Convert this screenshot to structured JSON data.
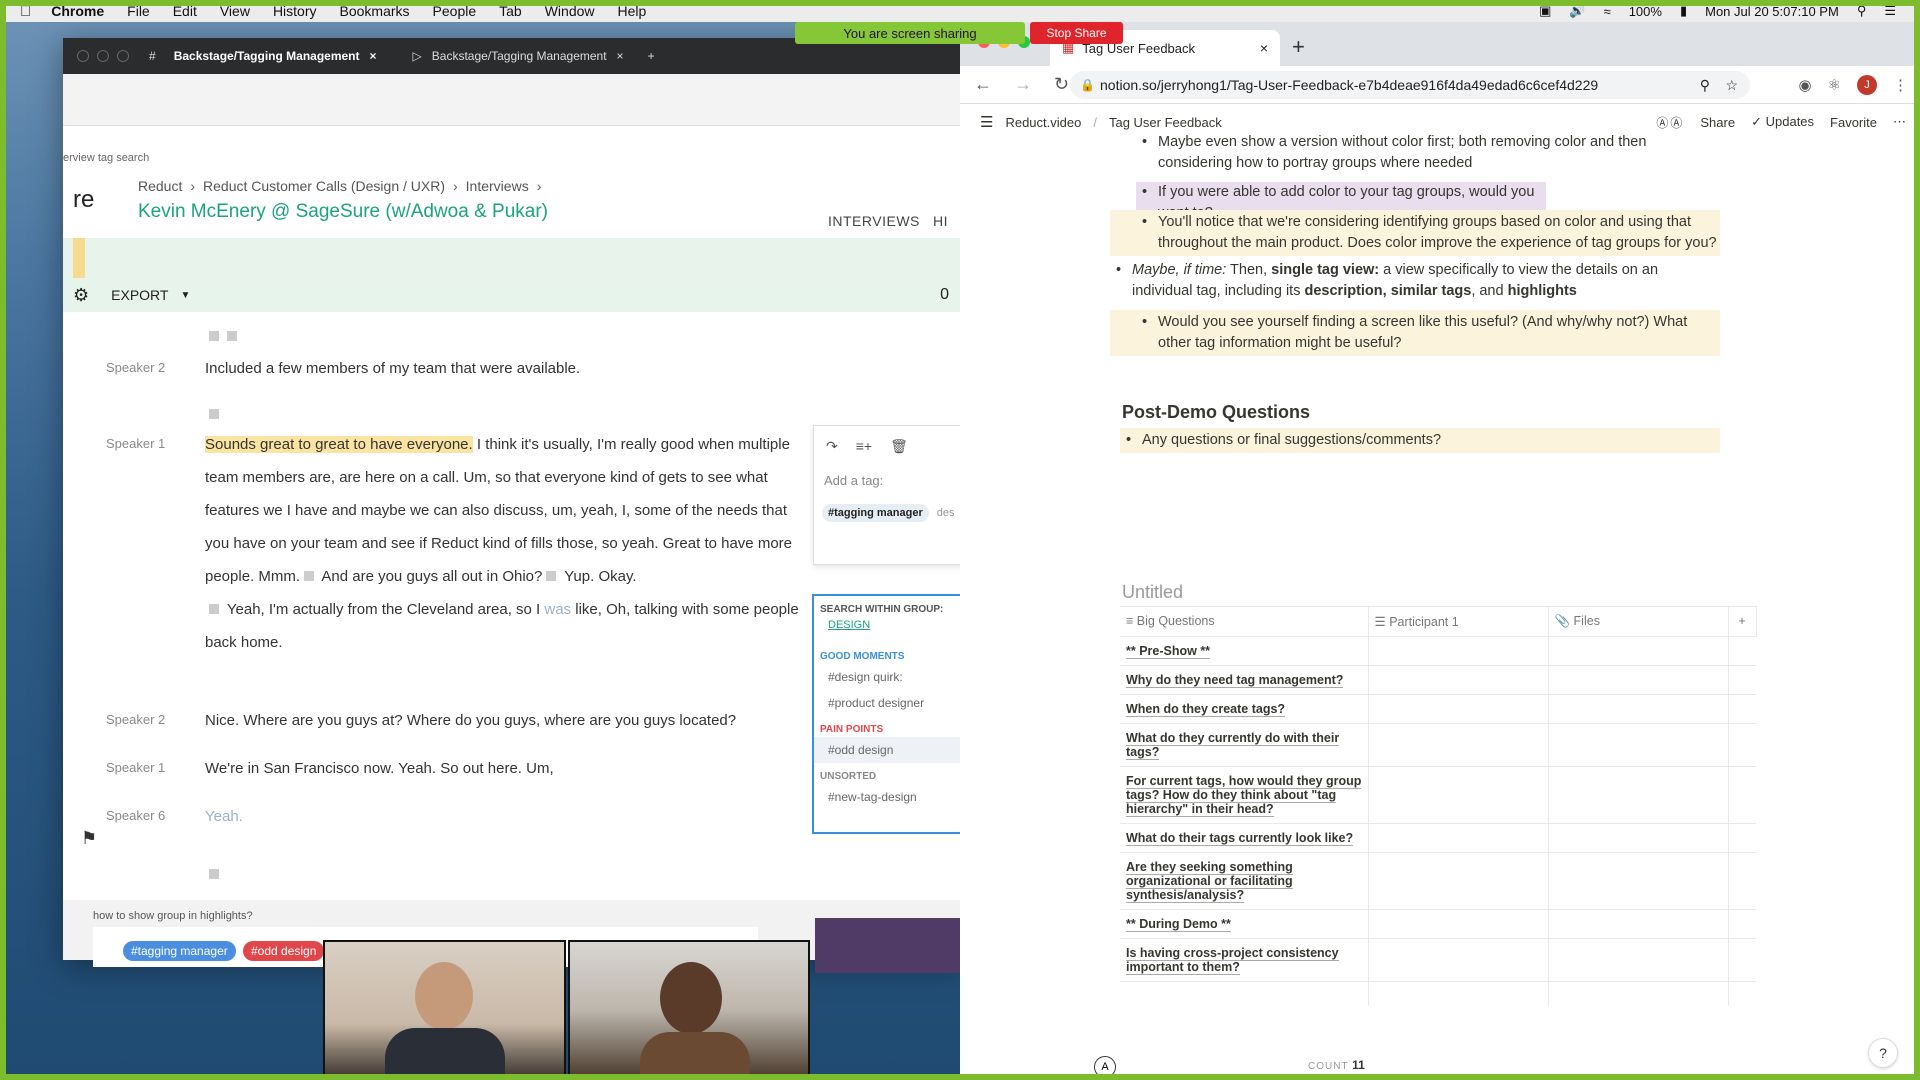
{
  "menubar": {
    "app": "Chrome",
    "items": [
      "File",
      "Edit",
      "View",
      "History",
      "Bookmarks",
      "People",
      "Tab",
      "Window",
      "Help"
    ],
    "battery": "100%",
    "datetime": "Mon Jul 20  5:07:10 PM"
  },
  "share": {
    "banner": "You are screen sharing",
    "stop": "Stop Share"
  },
  "left": {
    "tabs": [
      "Backstage/Tagging Management",
      "Backstage/Tagging Management"
    ],
    "tag_search_label": "erview tag search",
    "logo": "re",
    "breadcrumb": [
      "Reduct",
      "Reduct Customer Calls (Design / UXR)",
      "Interviews"
    ],
    "title": "Kevin McEnery @ SageSure (w/Adwoa & Pukar)",
    "nav_tab": "INTERVIEWS",
    "nav_tab_cut": "HI",
    "export": "EXPORT",
    "export_count": "0",
    "rows": [
      {
        "speaker": "Speaker 2",
        "text": "Included a few members of my team that were available."
      },
      {
        "speaker": "Speaker 1",
        "hl": "Sounds great to great to have everyone.",
        "text": " I think it's usually, I'm really good when multiple team members are, are here on a call. Um, so that everyone kind of gets to see what features we I have and maybe we can also discuss, um, yeah, I,",
        "faint1": " I,",
        "text2": " some of the needs that you have on your team and see if Reduct kind of fills those, so yeah. Great to have more people. Mmm.",
        "text3": " And are you guys all out in Ohio?",
        "text4": " Yup. Okay.",
        "text5": " Yeah, I'm actually from the Cleveland area, so I ",
        "faint2": "was",
        "text6": " like, Oh, talking with some people back home."
      },
      {
        "speaker": "Speaker 2",
        "text": "Nice. Where are you guys at? Where do you guys, where are you guys located?"
      },
      {
        "speaker": "Speaker 1",
        "text": "We're in San Francisco now. Yeah. So out here. Um,"
      },
      {
        "speaker": "Speaker 6",
        "text": "Yeah."
      }
    ],
    "tag_popover": {
      "placeholder": "Add a tag:",
      "chip": "#tagging manager",
      "chip_cut": "des"
    },
    "group_popover": {
      "search_label": "SEARCH WITHIN GROUP:",
      "group": "DESIGN",
      "sections": [
        {
          "title": "GOOD MOMENTS",
          "color": "#3b8fd8",
          "items": [
            "#design quirk:",
            "#product designer"
          ]
        },
        {
          "title": "PAIN POINTS",
          "color": "#e0474b",
          "items": [
            "#odd design"
          ]
        },
        {
          "title": "UNSORTED",
          "color": "#888888",
          "items": [
            "#new-tag-design"
          ]
        }
      ]
    },
    "bottom": {
      "question": "how to show group in highlights?",
      "pill1": "#tagging manager",
      "pill2": "#odd design"
    }
  },
  "chrome": {
    "tab_title": "Tag User Feedback",
    "url": "notion.so/jerryhong1/Tag-User-Feedback-e7b4deae916f4da49edad6c6cef4d229",
    "avatar": "J"
  },
  "notion": {
    "crumbs": [
      "Reduct.video",
      "Tag User Feedback"
    ],
    "actions": {
      "share": "Share",
      "updates": "Updates",
      "favorite": "Favorite"
    },
    "bullets": {
      "b1": "Maybe even show a version without color first; both removing color and then considering how to portray groups where needed",
      "b2": "If you were able to add color to your tag groups, would you want to?",
      "b3": "You'll notice that we're considering identifying groups based on color and using that throughout the main product. Does color improve the experience of tag groups for you?",
      "b4_italic": "Maybe, if time:",
      "b4_a": " Then, ",
      "b4_bold1": "single tag view:",
      "b4_b": " a view specifically to view the details on an individual tag, including its ",
      "b4_bold2": "description, similar tags",
      "b4_c": ", and ",
      "b4_bold3": "highlights",
      "b5": "Would you see yourself finding a screen like this useful? (And why/why not?) What other tag information might be useful?"
    },
    "post_demo_heading": "Post-Demo Questions",
    "post_demo_item": "Any questions or final suggestions/comments?",
    "db_title": "Untitled",
    "db_columns": [
      "Big Questions",
      "Participant 1",
      "Files"
    ],
    "db_rows": [
      "** Pre-Show **",
      "Why do they need tag management?",
      "When do they create tags?",
      "What do they currently do with their tags?",
      "For current tags, how would they group tags? How do they think about \"tag hierarchy\" in their head?",
      "What do their tags currently look like?",
      "Are they seeking something organizational or facilitating synthesis/analysis?",
      "** During Demo **",
      "Is having cross-project consistency important to them?"
    ],
    "count_label": "COUNT",
    "count_value": "11",
    "help": "?"
  }
}
